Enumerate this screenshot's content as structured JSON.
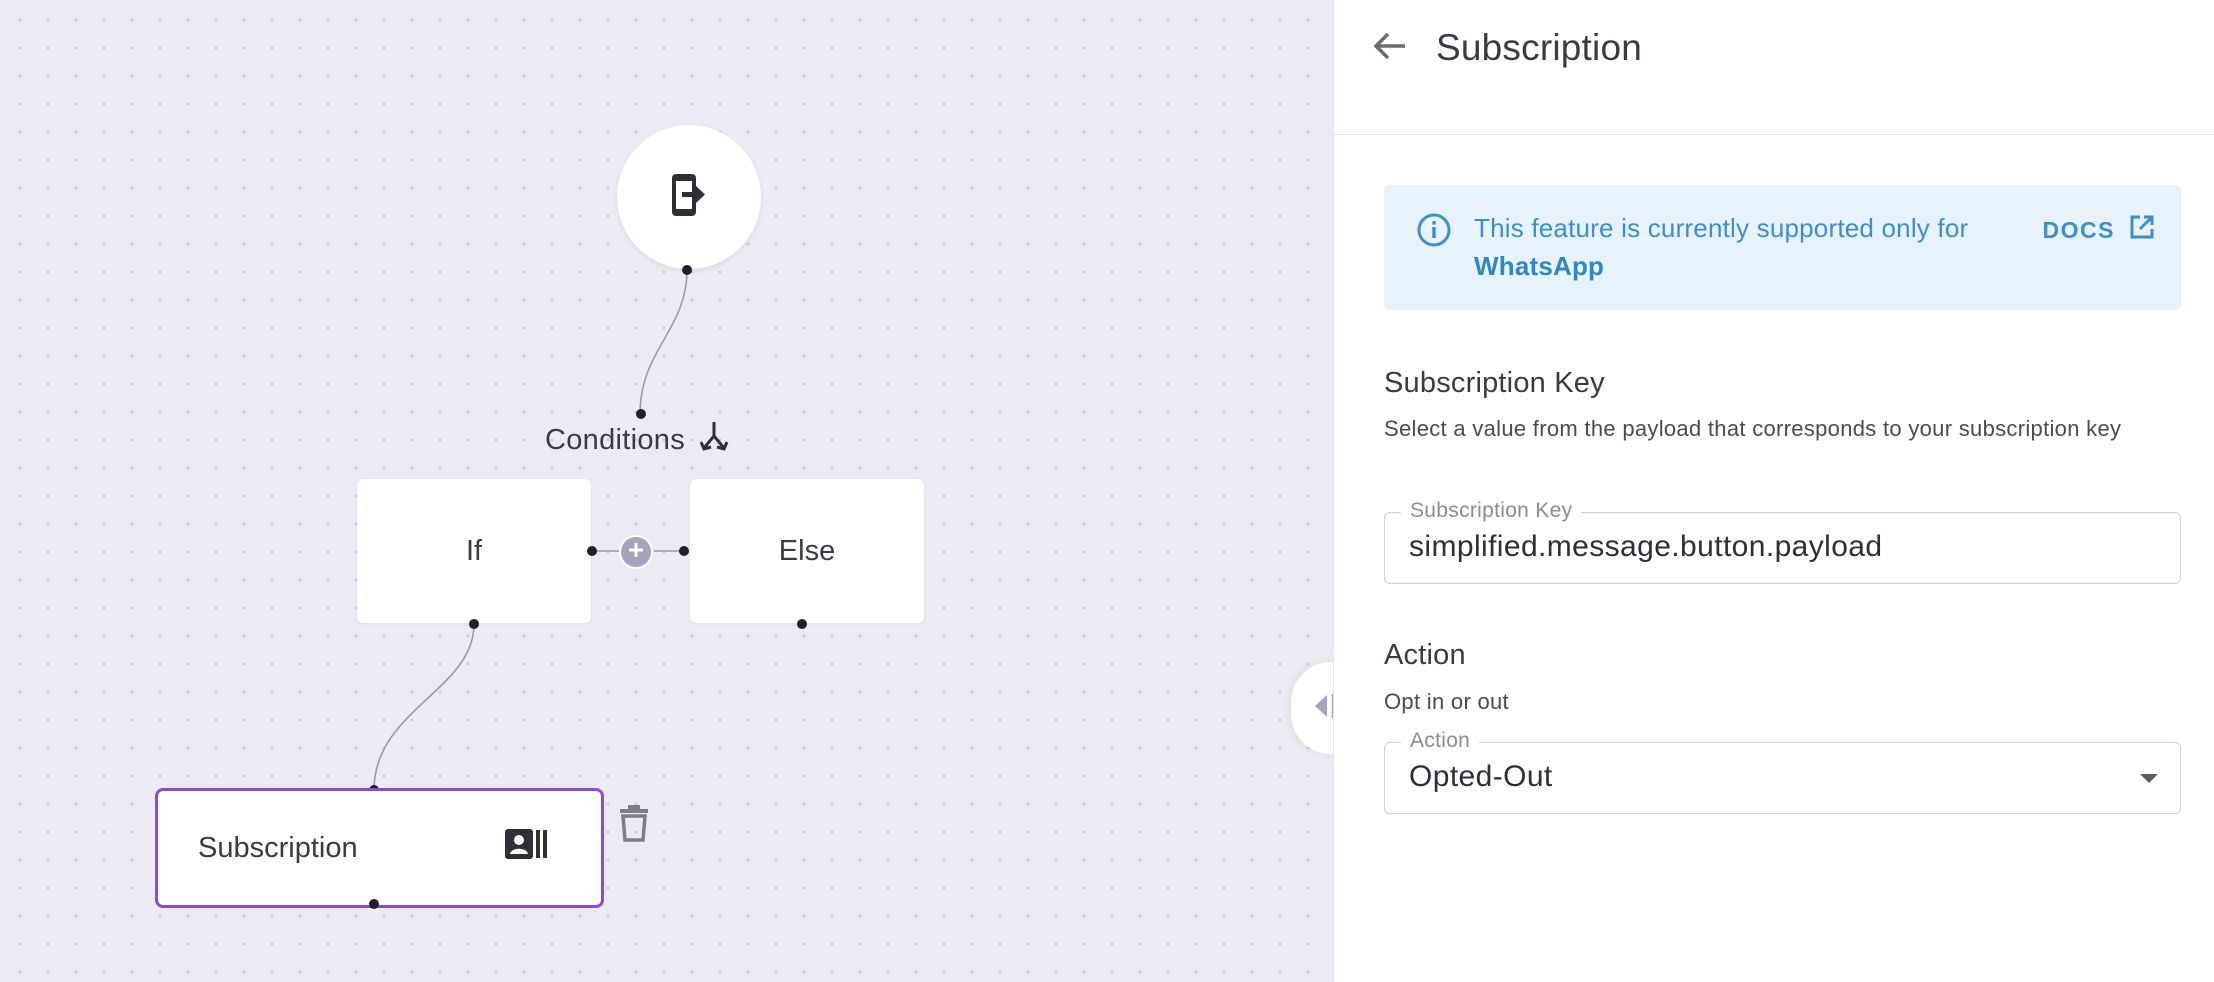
{
  "canvas": {
    "conditions_label": "Conditions",
    "if_label": "If",
    "else_label": "Else",
    "subscription_node_label": "Subscription",
    "icons": {
      "start": "exit-app-icon",
      "conditions": "split-arrows-icon",
      "add_branch": "plus-circle-icon",
      "subscription": "contact-card-icon",
      "delete": "trash-icon",
      "toggle": "collapse-arrows-icon"
    },
    "selected_color": "#8b4ad8"
  },
  "panel": {
    "title": "Subscription",
    "back_icon": "arrow-left-icon",
    "info": {
      "text": "This feature is currently supported only for",
      "highlight": "WhatsApp",
      "docs_label": "DOCS",
      "color": "#3b8fce",
      "background": "#e7f2fb"
    },
    "subscription_key": {
      "title": "Subscription Key",
      "description": "Select a value from the payload that corresponds to your subscription key",
      "field_label": "Subscription Key",
      "value": "simplified.message.button.payload"
    },
    "action": {
      "title": "Action",
      "description": "Opt in or out",
      "field_label": "Action",
      "value": "Opted-Out"
    }
  }
}
